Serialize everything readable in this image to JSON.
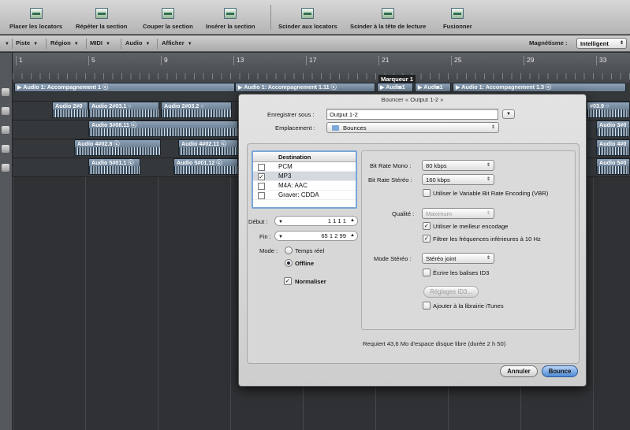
{
  "toolbar": {
    "buttons": [
      {
        "label": "Placer les locators",
        "icon": "set-locators-icon"
      },
      {
        "label": "Répéter la section",
        "icon": "repeat-section-icon"
      },
      {
        "label": "Couper la section",
        "icon": "cut-section-icon"
      },
      {
        "label": "Insérer la section",
        "icon": "insert-section-icon"
      },
      {
        "label": "Scinder aux locators",
        "icon": "split-locators-icon"
      },
      {
        "label": "Scinder à la tête de lecture",
        "icon": "split-playhead-icon"
      },
      {
        "label": "Fusionner",
        "icon": "merge-icon"
      }
    ]
  },
  "menubar": {
    "items": [
      "Piste",
      "Région",
      "MIDI",
      "Audio",
      "Afficher"
    ],
    "snap_label": "Magnétisme :",
    "snap_value": "Intelligent"
  },
  "ruler": {
    "bars": [
      "1",
      "5",
      "9",
      "13",
      "17",
      "21",
      "25",
      "29",
      "33"
    ],
    "marker": "Marqueur 1"
  },
  "tracks": {
    "row1": [
      "▶ Audio 1: Accompagnement 1 ⓒ",
      "▶ Audio 1: Accompagnement 1.11 ⓒ",
      "▶ Audi◙1",
      "▶ Audi◙1",
      "▶ Audio 1: Accompagnement 1.3 ⓒ"
    ],
    "row2": [
      "Audio 2#0",
      "Audio 2#03.1 ○",
      "Audio 2#03.2 ○",
      "#03.9 ○"
    ],
    "row3": [
      "Audio 3#08.11 ⓒ",
      "Audio 3#0"
    ],
    "row4": [
      "Audio 4#02.8 ⓒ",
      "Audio 4#02.11 ⓒ",
      "Audio 4#0"
    ],
    "row5": [
      "Audio 5#01.1 ⓒ",
      "Audio 5#01.12 ⓒ",
      "Audio 5#0"
    ]
  },
  "dialog": {
    "title": "Bouncer « Output 1-2 »",
    "save_as_label": "Enregistrer sous :",
    "save_as_value": "Output 1-2",
    "location_label": "Emplacement :",
    "location_value": "Bounces",
    "destination_header": "Destination",
    "destinations": [
      {
        "name": "PCM",
        "checked": false,
        "mark": ""
      },
      {
        "name": "MP3",
        "checked": true,
        "mark": "✓"
      },
      {
        "name": "M4A: AAC",
        "checked": false,
        "mark": ""
      },
      {
        "name": "Graver: CDDA",
        "checked": false,
        "mark": ""
      }
    ],
    "start_label": "Début :",
    "start_value": "1   1   1   1",
    "end_label": "Fin :",
    "end_value": "65   1   2   99",
    "mode_label": "Mode :",
    "mode_realtime": "Temps réel",
    "mode_offline": "Offline",
    "normalize_label": "Normaliser",
    "normalize_mark": "✓",
    "bitrate_mono_label": "Bit Rate Mono :",
    "bitrate_mono_value": "80 kbps",
    "bitrate_stereo_label": "Bit Rate Stéréo :",
    "bitrate_stereo_value": "160 kbps",
    "vbr_label": "Utiliser le Variable Bit Rate Encoding (VBR)",
    "quality_label": "Qualité :",
    "quality_value": "Maximum",
    "best_encoding_label": "Utiliser le meilleur encodage",
    "best_encoding_mark": "✓",
    "filter_label": "Filtrer les fréquences inférieures à 10 Hz",
    "filter_mark": "✓",
    "stereo_mode_label": "Mode Stéréo :",
    "stereo_mode_value": "Stéréo joint",
    "id3_label": "Écrire les balises ID3",
    "id3_button": "Réglages ID3...",
    "itunes_label": "Ajouter à la librairie iTunes",
    "disk_info": "Requiert 43,6 Mo d'espace disque libre (durée 2 h 50)",
    "cancel": "Annuler",
    "bounce": "Bounce"
  },
  "colors": {
    "accent": "#4d8ad6",
    "region": "#7b8a98"
  }
}
